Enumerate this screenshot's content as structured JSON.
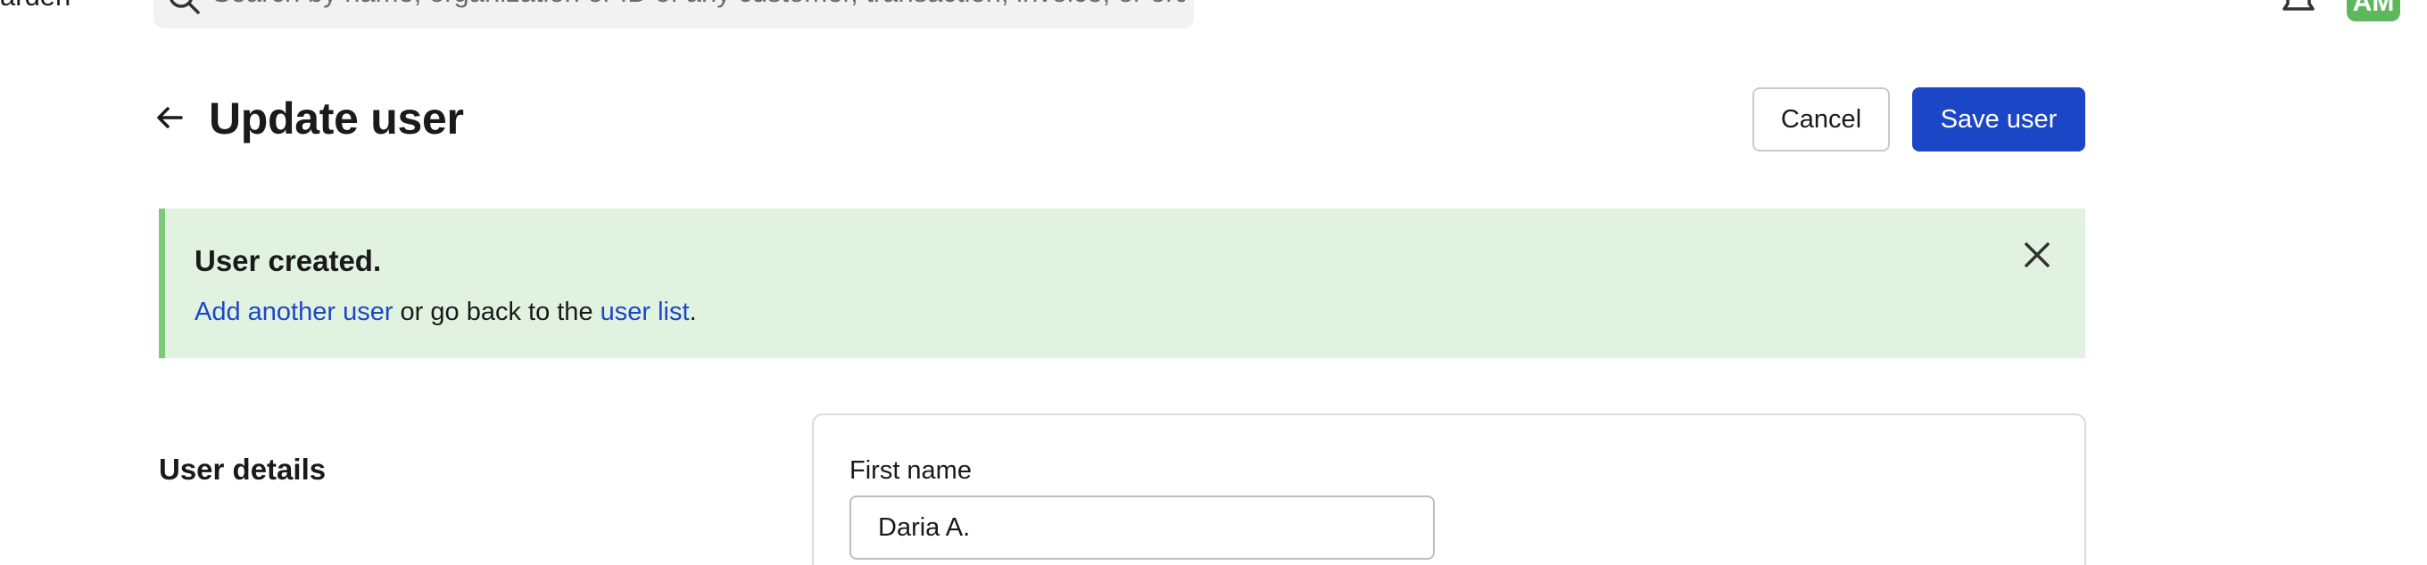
{
  "topbar": {
    "org_name": "arden",
    "search": {
      "placeholder": "Search by name, organization or ID of any customer, transaction, invoice, or order",
      "value": ""
    },
    "avatar_initials": "AM",
    "icons": {
      "org": "chevron-down-icon",
      "search": "search-icon",
      "notifications": "bell-icon"
    }
  },
  "header": {
    "title": "Update user",
    "back_icon": "arrow-left-icon",
    "cancel_label": "Cancel",
    "save_label": "Save user"
  },
  "banner": {
    "title": "User created.",
    "link_add": "Add another user",
    "middle_text": " or go back to the ",
    "link_list": "user list",
    "end_text": ".",
    "close_icon": "close-icon"
  },
  "user_details": {
    "section_title": "User details",
    "first_name_label": "First name",
    "first_name_value": "Daria A."
  },
  "colors": {
    "primary": "#1b47c7",
    "success_bg": "#e1f3e0",
    "success_border": "#7dc97b",
    "avatar_bg": "#5db85c"
  }
}
